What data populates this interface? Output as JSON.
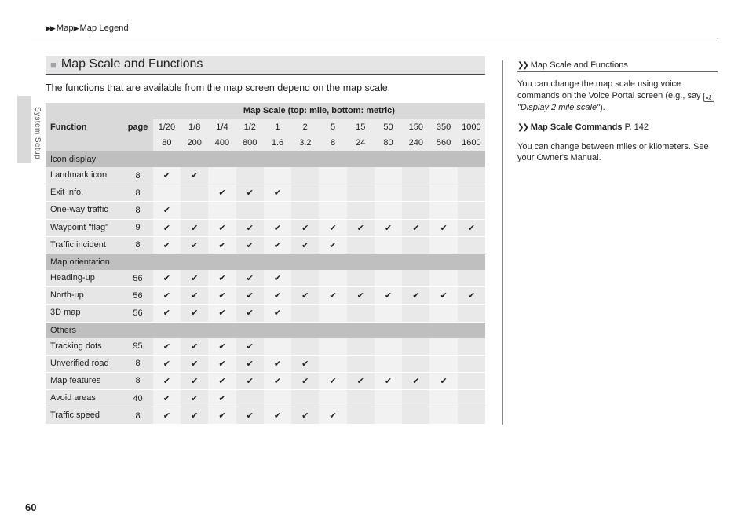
{
  "breadcrumb": {
    "a": "Map",
    "b": "Map Legend"
  },
  "side_label": "System Setup",
  "section_title": "Map Scale and Functions",
  "intro": "The functions that are available from the map screen depend on the map scale.",
  "table": {
    "col_function": "Function",
    "col_page": "page",
    "scale_header": "Map Scale (top: mile, bottom: metric)",
    "scales_top": [
      "1/20",
      "1/8",
      "1/4",
      "1/2",
      "1",
      "2",
      "5",
      "15",
      "50",
      "150",
      "350",
      "1000"
    ],
    "scales_bottom": [
      "80",
      "200",
      "400",
      "800",
      "1.6",
      "3.2",
      "8",
      "24",
      "80",
      "240",
      "560",
      "1600"
    ],
    "groups": [
      {
        "cat": "Icon display",
        "rows": [
          {
            "name": "Landmark icon",
            "page": "8",
            "checks": [
              1,
              1,
              0,
              0,
              0,
              0,
              0,
              0,
              0,
              0,
              0,
              0
            ]
          },
          {
            "name": "Exit info.",
            "page": "8",
            "checks": [
              0,
              0,
              1,
              1,
              1,
              0,
              0,
              0,
              0,
              0,
              0,
              0
            ]
          },
          {
            "name": "One-way traffic",
            "page": "8",
            "checks": [
              1,
              0,
              0,
              0,
              0,
              0,
              0,
              0,
              0,
              0,
              0,
              0
            ]
          },
          {
            "name": "Waypoint \"flag\"",
            "page": "9",
            "checks": [
              1,
              1,
              1,
              1,
              1,
              1,
              1,
              1,
              1,
              1,
              1,
              1
            ]
          },
          {
            "name": "Traffic incident",
            "page": "8",
            "checks": [
              1,
              1,
              1,
              1,
              1,
              1,
              1,
              0,
              0,
              0,
              0,
              0
            ]
          }
        ]
      },
      {
        "cat": "Map orientation",
        "rows": [
          {
            "name": "Heading-up",
            "page": "56",
            "checks": [
              1,
              1,
              1,
              1,
              1,
              0,
              0,
              0,
              0,
              0,
              0,
              0
            ]
          },
          {
            "name": "North-up",
            "page": "56",
            "checks": [
              1,
              1,
              1,
              1,
              1,
              1,
              1,
              1,
              1,
              1,
              1,
              1
            ]
          },
          {
            "name": "3D map",
            "page": "56",
            "checks": [
              1,
              1,
              1,
              1,
              1,
              0,
              0,
              0,
              0,
              0,
              0,
              0
            ]
          }
        ]
      },
      {
        "cat": "Others",
        "rows": [
          {
            "name": "Tracking dots",
            "page": "95",
            "checks": [
              1,
              1,
              1,
              1,
              0,
              0,
              0,
              0,
              0,
              0,
              0,
              0
            ]
          },
          {
            "name": "Unverified road",
            "page": "8",
            "checks": [
              1,
              1,
              1,
              1,
              1,
              1,
              0,
              0,
              0,
              0,
              0,
              0
            ]
          },
          {
            "name": "Map features",
            "page": "8",
            "checks": [
              1,
              1,
              1,
              1,
              1,
              1,
              1,
              1,
              1,
              1,
              1,
              0
            ]
          },
          {
            "name": "Avoid areas",
            "page": "40",
            "checks": [
              1,
              1,
              1,
              0,
              0,
              0,
              0,
              0,
              0,
              0,
              0,
              0
            ]
          },
          {
            "name": "Traffic speed",
            "page": "8",
            "checks": [
              1,
              1,
              1,
              1,
              1,
              1,
              1,
              0,
              0,
              0,
              0,
              0
            ]
          }
        ]
      }
    ]
  },
  "aside": {
    "title": "Map Scale and Functions",
    "p1a": "You can change the map scale using voice commands on the Voice Portal screen (e.g., say ",
    "p1b": "\"Display 2 mile scale\"",
    "p1c": ").",
    "link_label": "Map Scale Commands",
    "link_page_prefix": "P. ",
    "link_page": "142",
    "p2": "You can change between miles or kilometers. See your Owner's Manual."
  },
  "page_number": "60"
}
